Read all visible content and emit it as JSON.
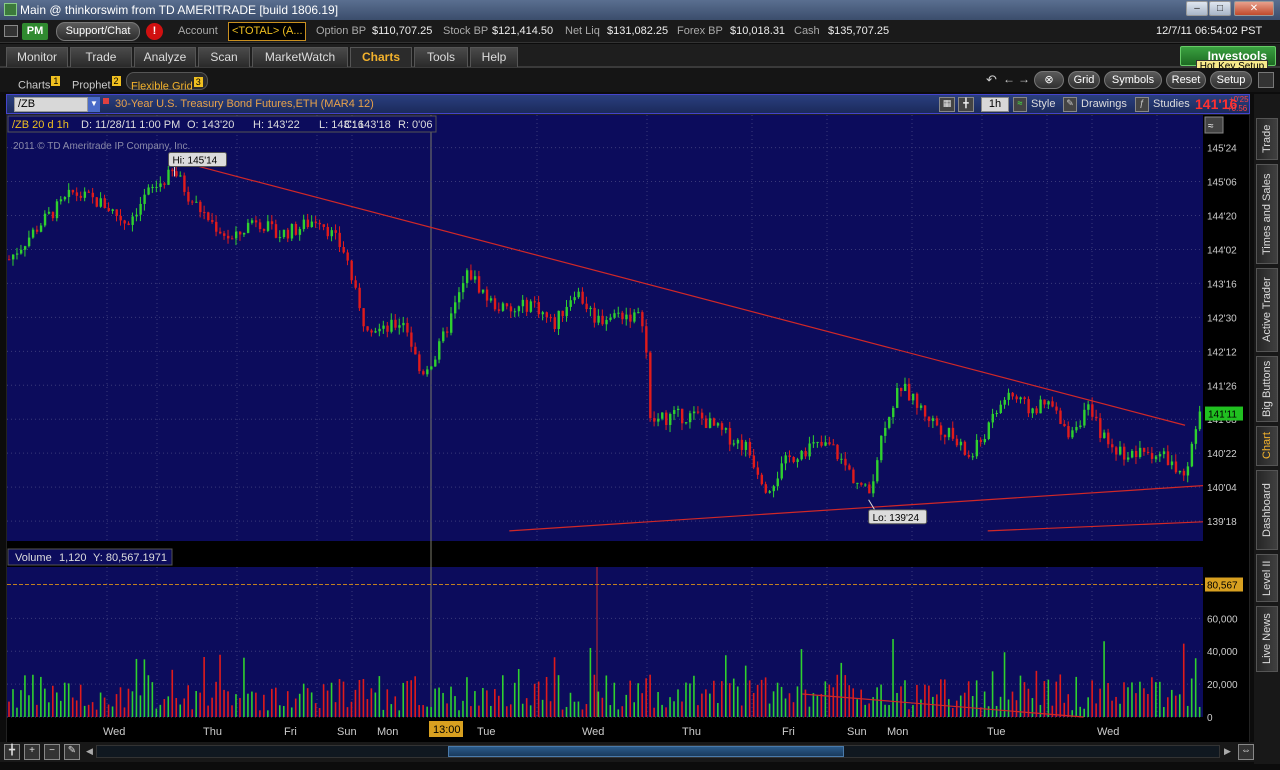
{
  "window": {
    "title": "Main @ thinkorswim from TD AMERITRADE [build 1806.19]",
    "datetime": "12/7/11 06:54:02 PST"
  },
  "account": {
    "mode": "PM",
    "support": "Support/Chat",
    "alert": "!",
    "account_label": "Account",
    "account_value": "<TOTAL> (A...",
    "option_bp_label": "Option BP",
    "option_bp": "$110,707.25",
    "stock_bp_label": "Stock BP",
    "stock_bp": "$121,414.50",
    "net_liq_label": "Net Liq",
    "net_liq": "$131,082.25",
    "forex_bp_label": "Forex BP",
    "forex_bp": "$10,018.31",
    "cash_label": "Cash",
    "cash": "$135,707.25"
  },
  "main_tabs": [
    "Monitor",
    "Trade",
    "Analyze",
    "Scan",
    "MarketWatch",
    "Charts",
    "Tools",
    "Help"
  ],
  "investools": {
    "label": "Investools",
    "tooltip": "Hot Key Setup"
  },
  "sub_tabs": [
    {
      "label": "Charts",
      "num": "1"
    },
    {
      "label": "Prophet",
      "num": "2"
    },
    {
      "label": "Flexible Grid",
      "num": "3"
    }
  ],
  "toolbar": {
    "grid": "Grid",
    "symbols": "Symbols",
    "reset": "Reset",
    "setup": "Setup"
  },
  "chart_header": {
    "symbol": "/ZB",
    "description": "30-Year U.S. Treasury Bond Futures,ETH (MAR4 12)",
    "timeframe": "1h",
    "style": "Style",
    "drawings": "Drawings",
    "studies": "Studies",
    "last_price": "141'16",
    "change_abs": "+0'25",
    "change_pct": "+0.56 %"
  },
  "chart_info": {
    "title": "/ZB 20 d 1h",
    "date": "D: 11/28/11 1:00 PM",
    "open": "O: 143'20",
    "high": "H: 143'22",
    "low": "L: 143'16",
    "close": "C: 143'18",
    "range": "R: 0'06"
  },
  "copyright": "2011 © TD Ameritrade IP Company, Inc.",
  "volume_info": {
    "label": "Volume",
    "value": "1,120",
    "y": "Y: 80,567.1971"
  },
  "right_tabs": [
    "Trade",
    "Times and Sales",
    "Active Trader",
    "Big Buttons",
    "Chart",
    "Dashboard",
    "Level II",
    "Live News"
  ],
  "colors": {
    "up": "#2fd12f",
    "down": "#e01b1b",
    "trend": "#d02828",
    "plot_bg": "#0c0c5c",
    "accent": "#f3b22c"
  },
  "chart_data": {
    "type": "candlestick",
    "symbol": "/ZB",
    "price_ticks": [
      "145'24",
      "145'06",
      "144'20",
      "144'02",
      "143'16",
      "142'30",
      "142'12",
      "141'26",
      "141'08",
      "140'22",
      "140'04",
      "139'18"
    ],
    "price_ticks_dec": [
      145.75,
      145.1875,
      144.625,
      144.0625,
      143.5,
      142.9375,
      142.375,
      141.8125,
      141.25,
      140.6875,
      140.125,
      139.5625
    ],
    "volume_ticks": [
      "60,000",
      "40,000",
      "20,000",
      "0"
    ],
    "volume_ticks_val": [
      60000,
      40000,
      20000,
      0
    ],
    "volume_marker": {
      "label": "80,567",
      "value": 80567
    },
    "x_labels": [
      "Wed",
      "Thu",
      "Fri",
      "Sun",
      "Mon",
      "13:00",
      "Tue",
      "Wed",
      "Thu",
      "Fri",
      "Sun",
      "Mon",
      "Tue",
      "Wed"
    ],
    "annotations": {
      "high": {
        "label": "Hi: 145'14",
        "value": 145.4375
      },
      "low": {
        "label": "Lo: 139'24",
        "value": 139.75
      }
    },
    "current_price": {
      "label": "141'11",
      "value": 141.344
    },
    "trendlines": [
      {
        "name": "upper",
        "from": [
          0.158,
          145.45
        ],
        "to": [
          0.985,
          141.15
        ]
      },
      {
        "name": "lower",
        "from": [
          0.42,
          139.4
        ],
        "to": [
          1.0,
          140.15
        ]
      },
      {
        "name": "lower2",
        "from": [
          0.82,
          139.4
        ],
        "to": [
          1.0,
          139.55
        ]
      },
      {
        "name": "volume",
        "from": [
          0.665,
          14000
        ],
        "to": [
          0.9,
          0
        ]
      }
    ],
    "close_keypoints": [
      [
        0,
        143.9
      ],
      [
        0.03,
        144.5
      ],
      [
        0.06,
        145.0
      ],
      [
        0.09,
        144.8
      ],
      [
        0.11,
        144.5
      ],
      [
        0.13,
        145.0
      ],
      [
        0.155,
        145.35
      ],
      [
        0.17,
        144.9
      ],
      [
        0.19,
        144.5
      ],
      [
        0.21,
        144.2
      ],
      [
        0.23,
        144.6
      ],
      [
        0.25,
        144.3
      ],
      [
        0.27,
        144.4
      ],
      [
        0.29,
        144.6
      ],
      [
        0.315,
        144.0
      ],
      [
        0.33,
        142.9
      ],
      [
        0.35,
        142.7
      ],
      [
        0.37,
        142.9
      ],
      [
        0.385,
        142.0
      ],
      [
        0.4,
        142.3
      ],
      [
        0.415,
        143.0
      ],
      [
        0.43,
        143.7
      ],
      [
        0.45,
        143.2
      ],
      [
        0.47,
        143.0
      ],
      [
        0.49,
        143.2
      ],
      [
        0.51,
        142.8
      ],
      [
        0.53,
        143.4
      ],
      [
        0.55,
        142.9
      ],
      [
        0.575,
        143.0
      ],
      [
        0.595,
        142.9
      ],
      [
        0.6,
        141.2
      ],
      [
        0.62,
        141.3
      ],
      [
        0.645,
        141.3
      ],
      [
        0.67,
        141.0
      ],
      [
        0.69,
        140.8
      ],
      [
        0.71,
        140.1
      ],
      [
        0.73,
        140.6
      ],
      [
        0.75,
        140.8
      ],
      [
        0.77,
        140.8
      ],
      [
        0.79,
        140.3
      ],
      [
        0.805,
        140.0
      ],
      [
        0.82,
        141.2
      ],
      [
        0.835,
        141.8
      ],
      [
        0.86,
        141.3
      ],
      [
        0.88,
        141.0
      ],
      [
        0.9,
        140.6
      ],
      [
        0.92,
        141.2
      ],
      [
        0.935,
        141.7
      ],
      [
        0.955,
        141.4
      ],
      [
        0.975,
        141.5
      ],
      [
        0.99,
        141.0
      ],
      [
        1.01,
        141.4
      ],
      [
        1.03,
        140.8
      ],
      [
        1.05,
        140.65
      ],
      [
        1.07,
        140.7
      ],
      [
        1.085,
        140.6
      ],
      [
        1.1,
        140.2
      ],
      [
        1.115,
        141.3
      ]
    ]
  }
}
